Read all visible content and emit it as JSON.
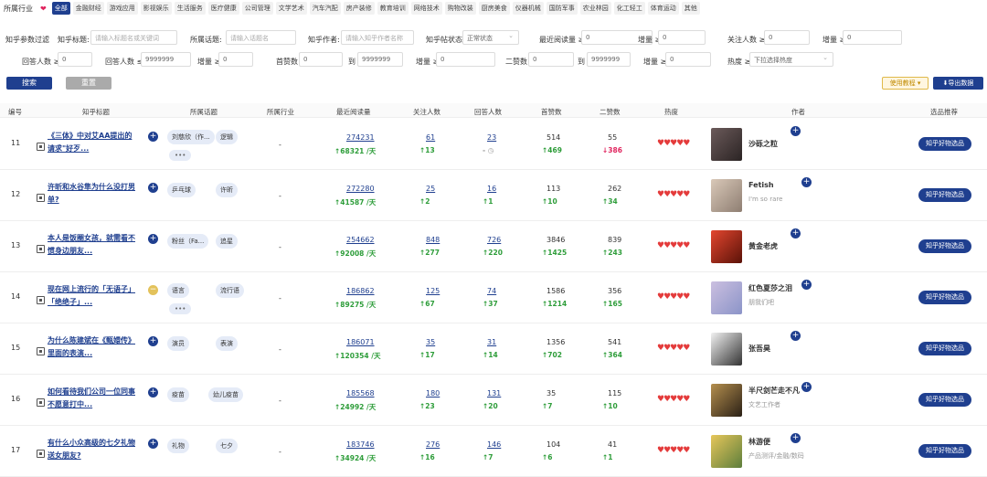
{
  "industry": {
    "label": "所属行业",
    "chips": [
      "全部",
      "金融财经",
      "游戏应用",
      "影视娱乐",
      "生活服务",
      "医疗健康",
      "公司管理",
      "文学艺术",
      "汽车汽配",
      "房产装修",
      "教育培训",
      "网络技术",
      "购物改装",
      "厨房美食",
      "仪器机械",
      "国防军事",
      "农业林园",
      "化工轻工",
      "体育运动",
      "其他"
    ]
  },
  "filters": {
    "section_label": "知乎参数过滤",
    "title_label": "知乎标题:",
    "title_ph": "请输入标题名或关键词",
    "topic_label": "所属话题:",
    "topic_ph": "请输入话题名",
    "author_label": "知乎作者:",
    "author_ph": "请输入知乎作者名称",
    "status_label": "知乎帖状态",
    "status_val": "正常状态",
    "reads_label": "最近阅读量 ≥",
    "reads_val": "0",
    "inc1_label": "增量 ≥",
    "inc1_val": "0",
    "follow_label": "关注人数 ≥",
    "follow_val": "0",
    "inc2_label": "增量 ≥",
    "inc2_val": "0",
    "ans_label": "回答人数 ≥",
    "ans_val": "0",
    "ans2_label": "回答人数 ≤",
    "ans2_val": "9999999",
    "inc3_label": "增量 ≥",
    "inc3_val": "0",
    "first_label": "首赞数",
    "first_from": "0",
    "to1": "到",
    "first_to": "9999999",
    "inc4_label": "增量 ≥",
    "inc4_val": "0",
    "second_label": "二赞数",
    "second_from": "0",
    "to2": "到",
    "second_to": "9999999",
    "inc5_label": "增量 ≥",
    "inc5_val": "0",
    "heat_label": "热度 ≥",
    "heat_val": "下拉选择热度"
  },
  "actions": {
    "search": "搜索",
    "reset": "重置",
    "tutorial": "使用教程 ▾",
    "export": "⬇导出数据"
  },
  "headers": {
    "idx": "编号",
    "title": "知乎标题",
    "topic": "所属话题",
    "industry": "所属行业",
    "reads": "最近阅读量",
    "follow": "关注人数",
    "answers": "回答人数",
    "first": "首赞数",
    "second": "二赞数",
    "heat": "热度",
    "author": "作者",
    "rec": "选品推荐"
  },
  "rows": [
    {
      "idx": "11",
      "title": "《三体》中对艾AA提出的请求\"好歹...",
      "tags": [
        "刘慈欣（作...",
        "逻辑"
      ],
      "more": "•••",
      "ind": "-",
      "reads": "274231",
      "reads_inc": "↑68321 /天",
      "follow": "61",
      "follow_inc": "↑13",
      "ans": "23",
      "ans_inc": "- ◷",
      "first": "514",
      "first_inc": "↑469",
      "second": "55",
      "second_inc": "↓386",
      "second_neg": true,
      "author": "沙砾之粒",
      "sub": "",
      "rec": "知乎好物选品",
      "plus": "b"
    },
    {
      "idx": "12",
      "title": "许昕和水谷隼为什么没打男单?",
      "tags": [
        "乒乓球",
        "许昕"
      ],
      "more": "",
      "ind": "-",
      "reads": "272280",
      "reads_inc": "↑41587 /天",
      "follow": "25",
      "follow_inc": "↑2",
      "ans": "16",
      "ans_inc": "↑1",
      "first": "113",
      "first_inc": "↑10",
      "second": "262",
      "second_inc": "↑34",
      "second_neg": false,
      "author": "Fetish",
      "sub": "I'm so rare",
      "rec": "知乎好物选品",
      "plus": "b"
    },
    {
      "idx": "13",
      "title": "本人是饭圈女孩，就需看不惯身边朋友...",
      "tags": [
        "粉丝（Fa...",
        "追星"
      ],
      "more": "",
      "ind": "-",
      "reads": "254662",
      "reads_inc": "↑92008 /天",
      "follow": "848",
      "follow_inc": "↑277",
      "ans": "726",
      "ans_inc": "↑220",
      "first": "3846",
      "first_inc": "↑1425",
      "second": "839",
      "second_inc": "↑243",
      "second_neg": false,
      "author": "黄金老虎",
      "sub": "",
      "rec": "知乎好物选品",
      "plus": "b"
    },
    {
      "idx": "14",
      "title": "现在网上流行的「无语子」「绝绝子」...",
      "tags": [
        "语言",
        "流行语"
      ],
      "more": "•••",
      "ind": "-",
      "reads": "186862",
      "reads_inc": "↑89275 /天",
      "follow": "125",
      "follow_inc": "↑67",
      "ans": "74",
      "ans_inc": "↑37",
      "first": "1586",
      "first_inc": "↑1214",
      "second": "356",
      "second_inc": "↑165",
      "second_neg": false,
      "author": "红色夏莎之泪",
      "sub": "朋我们吧",
      "rec": "知乎好物选品",
      "plus": "y"
    },
    {
      "idx": "15",
      "title": "为什么陈建斌在《甄嬛传》里面的表演...",
      "tags": [
        "演员",
        "表演"
      ],
      "more": "",
      "ind": "-",
      "reads": "186071",
      "reads_inc": "↑120354 /天",
      "follow": "35",
      "follow_inc": "↑17",
      "ans": "31",
      "ans_inc": "↑14",
      "first": "1356",
      "first_inc": "↑702",
      "second": "541",
      "second_inc": "↑364",
      "second_neg": false,
      "author": "张吾昊",
      "sub": "",
      "rec": "知乎好物选品",
      "plus": "b"
    },
    {
      "idx": "16",
      "title": "如何看待我们公司一位同事不愿意打中...",
      "tags": [
        "疫苗",
        "幼儿疫苗"
      ],
      "more": "",
      "ind": "-",
      "reads": "185568",
      "reads_inc": "↑24992 /天",
      "follow": "180",
      "follow_inc": "↑23",
      "ans": "131",
      "ans_inc": "↑20",
      "first": "35",
      "first_inc": "↑7",
      "second": "115",
      "second_inc": "↑10",
      "second_neg": false,
      "author": "半尺剑芒走不凡",
      "sub": "文艺工作者",
      "rec": "知乎好物选品",
      "plus": "b"
    },
    {
      "idx": "17",
      "title": "有什么小众高级的七夕礼物送女朋友?",
      "tags": [
        "礼物",
        "七夕"
      ],
      "more": "",
      "ind": "-",
      "reads": "183746",
      "reads_inc": "↑34924 /天",
      "follow": "276",
      "follow_inc": "↑16",
      "ans": "146",
      "ans_inc": "↑7",
      "first": "104",
      "first_inc": "↑6",
      "second": "41",
      "second_inc": "↑1",
      "second_neg": false,
      "author": "林游便",
      "sub": "产品测评/金融/数码",
      "rec": "知乎好物选品",
      "plus": "b"
    }
  ],
  "heat_symbol": "♥♥♥♥♥",
  "colors": {
    "primary": "#1f3f8f",
    "up": "#2e9d3a",
    "down": "#e0245e",
    "heat": "#e43b3b"
  }
}
